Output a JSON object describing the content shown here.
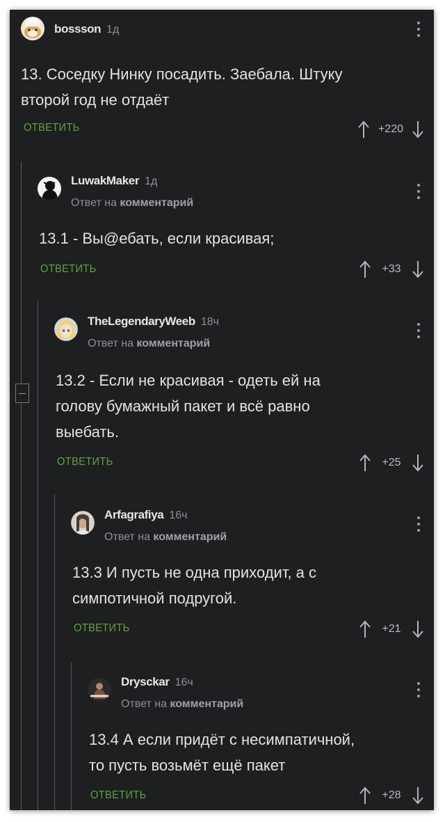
{
  "colors": {
    "background": "#1e1f21",
    "reply_link": "#5fa23a",
    "text": "#e2e3e5",
    "muted": "#8d9095"
  },
  "comments": [
    {
      "username": "bossson",
      "time": "1д",
      "reply_note_prefix": "",
      "reply_note_link": "",
      "text": "13. Соседку Нинку посадить. Заебала. Штуку\nвторой год не отдаёт",
      "reply_label": "ОТВЕТИТЬ",
      "score": "+220",
      "avatar": "hamster-avatar"
    },
    {
      "username": "LuwakMaker",
      "time": "1д",
      "reply_note_prefix": "Ответ на",
      "reply_note_link": "комментарий",
      "text": "13.1 - Вы@ебать, если красивая;",
      "reply_label": "ОТВЕТИТЬ",
      "score": "+33",
      "avatar": "silhouette-avatar"
    },
    {
      "username": "TheLegendaryWeeb",
      "time": "18ч",
      "reply_note_prefix": "Ответ на",
      "reply_note_link": "комментарий",
      "text": "13.2 - Если не красивая - одеть ей на\nголову бумажный пакет и всё равно\nвыебать.",
      "reply_label": "ОТВЕТИТЬ",
      "score": "+25",
      "avatar": "anime-girl-avatar"
    },
    {
      "username": "Arfagrafiya",
      "time": "16ч",
      "reply_note_prefix": "Ответ на",
      "reply_note_link": "комментарий",
      "text": "13.3 И пусть не одна приходит, а с\nсимпотичной подругой.",
      "reply_label": "ОТВЕТИТЬ",
      "score": "+21",
      "avatar": "photo-avatar"
    },
    {
      "username": "Drysckar",
      "time": "16ч",
      "reply_note_prefix": "Ответ на",
      "reply_note_link": "комментарий",
      "text": "13.4 А если придёт с несимпатичной,\nто пусть возьмёт ещё пакет",
      "reply_label": "ОТВЕТИТЬ",
      "score": "+28",
      "avatar": "figure-avatar"
    }
  ],
  "icons": {
    "upvote": "arrow-up-icon",
    "downvote": "arrow-down-icon",
    "menu": "more-vertical-icon",
    "collapse": "collapse-thread-icon"
  }
}
